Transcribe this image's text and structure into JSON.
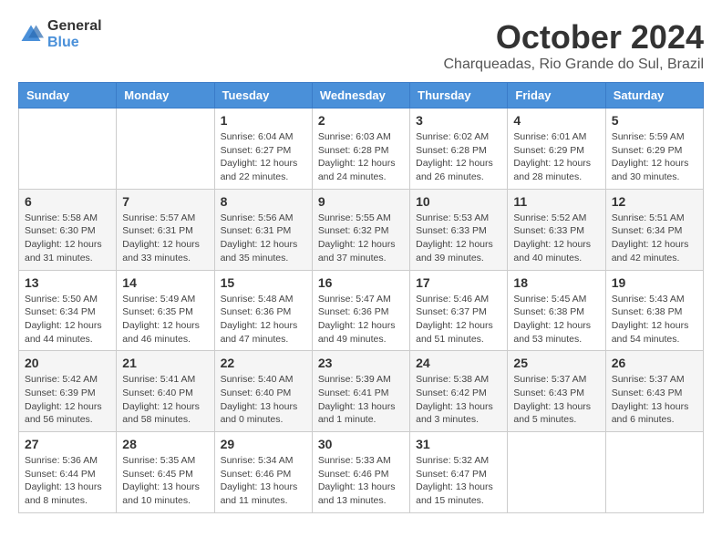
{
  "logo": {
    "line1": "General",
    "line2": "Blue"
  },
  "title": "October 2024",
  "location": "Charqueadas, Rio Grande do Sul, Brazil",
  "weekdays": [
    "Sunday",
    "Monday",
    "Tuesday",
    "Wednesday",
    "Thursday",
    "Friday",
    "Saturday"
  ],
  "weeks": [
    [
      {
        "day": "",
        "info": ""
      },
      {
        "day": "",
        "info": ""
      },
      {
        "day": "1",
        "info": "Sunrise: 6:04 AM\nSunset: 6:27 PM\nDaylight: 12 hours\nand 22 minutes."
      },
      {
        "day": "2",
        "info": "Sunrise: 6:03 AM\nSunset: 6:28 PM\nDaylight: 12 hours\nand 24 minutes."
      },
      {
        "day": "3",
        "info": "Sunrise: 6:02 AM\nSunset: 6:28 PM\nDaylight: 12 hours\nand 26 minutes."
      },
      {
        "day": "4",
        "info": "Sunrise: 6:01 AM\nSunset: 6:29 PM\nDaylight: 12 hours\nand 28 minutes."
      },
      {
        "day": "5",
        "info": "Sunrise: 5:59 AM\nSunset: 6:29 PM\nDaylight: 12 hours\nand 30 minutes."
      }
    ],
    [
      {
        "day": "6",
        "info": "Sunrise: 5:58 AM\nSunset: 6:30 PM\nDaylight: 12 hours\nand 31 minutes."
      },
      {
        "day": "7",
        "info": "Sunrise: 5:57 AM\nSunset: 6:31 PM\nDaylight: 12 hours\nand 33 minutes."
      },
      {
        "day": "8",
        "info": "Sunrise: 5:56 AM\nSunset: 6:31 PM\nDaylight: 12 hours\nand 35 minutes."
      },
      {
        "day": "9",
        "info": "Sunrise: 5:55 AM\nSunset: 6:32 PM\nDaylight: 12 hours\nand 37 minutes."
      },
      {
        "day": "10",
        "info": "Sunrise: 5:53 AM\nSunset: 6:33 PM\nDaylight: 12 hours\nand 39 minutes."
      },
      {
        "day": "11",
        "info": "Sunrise: 5:52 AM\nSunset: 6:33 PM\nDaylight: 12 hours\nand 40 minutes."
      },
      {
        "day": "12",
        "info": "Sunrise: 5:51 AM\nSunset: 6:34 PM\nDaylight: 12 hours\nand 42 minutes."
      }
    ],
    [
      {
        "day": "13",
        "info": "Sunrise: 5:50 AM\nSunset: 6:34 PM\nDaylight: 12 hours\nand 44 minutes."
      },
      {
        "day": "14",
        "info": "Sunrise: 5:49 AM\nSunset: 6:35 PM\nDaylight: 12 hours\nand 46 minutes."
      },
      {
        "day": "15",
        "info": "Sunrise: 5:48 AM\nSunset: 6:36 PM\nDaylight: 12 hours\nand 47 minutes."
      },
      {
        "day": "16",
        "info": "Sunrise: 5:47 AM\nSunset: 6:36 PM\nDaylight: 12 hours\nand 49 minutes."
      },
      {
        "day": "17",
        "info": "Sunrise: 5:46 AM\nSunset: 6:37 PM\nDaylight: 12 hours\nand 51 minutes."
      },
      {
        "day": "18",
        "info": "Sunrise: 5:45 AM\nSunset: 6:38 PM\nDaylight: 12 hours\nand 53 minutes."
      },
      {
        "day": "19",
        "info": "Sunrise: 5:43 AM\nSunset: 6:38 PM\nDaylight: 12 hours\nand 54 minutes."
      }
    ],
    [
      {
        "day": "20",
        "info": "Sunrise: 5:42 AM\nSunset: 6:39 PM\nDaylight: 12 hours\nand 56 minutes."
      },
      {
        "day": "21",
        "info": "Sunrise: 5:41 AM\nSunset: 6:40 PM\nDaylight: 12 hours\nand 58 minutes."
      },
      {
        "day": "22",
        "info": "Sunrise: 5:40 AM\nSunset: 6:40 PM\nDaylight: 13 hours\nand 0 minutes."
      },
      {
        "day": "23",
        "info": "Sunrise: 5:39 AM\nSunset: 6:41 PM\nDaylight: 13 hours\nand 1 minute."
      },
      {
        "day": "24",
        "info": "Sunrise: 5:38 AM\nSunset: 6:42 PM\nDaylight: 13 hours\nand 3 minutes."
      },
      {
        "day": "25",
        "info": "Sunrise: 5:37 AM\nSunset: 6:43 PM\nDaylight: 13 hours\nand 5 minutes."
      },
      {
        "day": "26",
        "info": "Sunrise: 5:37 AM\nSunset: 6:43 PM\nDaylight: 13 hours\nand 6 minutes."
      }
    ],
    [
      {
        "day": "27",
        "info": "Sunrise: 5:36 AM\nSunset: 6:44 PM\nDaylight: 13 hours\nand 8 minutes."
      },
      {
        "day": "28",
        "info": "Sunrise: 5:35 AM\nSunset: 6:45 PM\nDaylight: 13 hours\nand 10 minutes."
      },
      {
        "day": "29",
        "info": "Sunrise: 5:34 AM\nSunset: 6:46 PM\nDaylight: 13 hours\nand 11 minutes."
      },
      {
        "day": "30",
        "info": "Sunrise: 5:33 AM\nSunset: 6:46 PM\nDaylight: 13 hours\nand 13 minutes."
      },
      {
        "day": "31",
        "info": "Sunrise: 5:32 AM\nSunset: 6:47 PM\nDaylight: 13 hours\nand 15 minutes."
      },
      {
        "day": "",
        "info": ""
      },
      {
        "day": "",
        "info": ""
      }
    ]
  ]
}
